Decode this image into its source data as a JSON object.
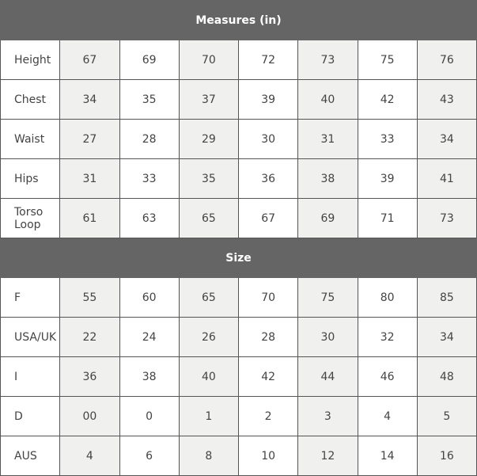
{
  "sections": [
    {
      "title": "Measures (in)",
      "rows": [
        {
          "label": "Height",
          "values": [
            "67",
            "69",
            "70",
            "72",
            "73",
            "75",
            "76"
          ]
        },
        {
          "label": "Chest",
          "values": [
            "34",
            "35",
            "37",
            "39",
            "40",
            "42",
            "43"
          ]
        },
        {
          "label": "Waist",
          "values": [
            "27",
            "28",
            "29",
            "30",
            "31",
            "33",
            "34"
          ]
        },
        {
          "label": "Hips",
          "values": [
            "31",
            "33",
            "35",
            "36",
            "38",
            "39",
            "41"
          ]
        },
        {
          "label": "Torso Loop",
          "values": [
            "61",
            "63",
            "65",
            "67",
            "69",
            "71",
            "73"
          ]
        }
      ]
    },
    {
      "title": "Size",
      "rows": [
        {
          "label": "F",
          "values": [
            "55",
            "60",
            "65",
            "70",
            "75",
            "80",
            "85"
          ]
        },
        {
          "label": "USA/UK",
          "values": [
            "22",
            "24",
            "26",
            "28",
            "30",
            "32",
            "34"
          ]
        },
        {
          "label": "I",
          "values": [
            "36",
            "38",
            "40",
            "42",
            "44",
            "46",
            "48"
          ]
        },
        {
          "label": "D",
          "values": [
            "00",
            "0",
            "1",
            "2",
            "3",
            "4",
            "5"
          ]
        },
        {
          "label": "AUS",
          "values": [
            "4",
            "6",
            "8",
            "10",
            "12",
            "14",
            "16"
          ]
        }
      ]
    }
  ],
  "colors": {
    "header": "#656565",
    "shade": "#f0f0ee"
  }
}
